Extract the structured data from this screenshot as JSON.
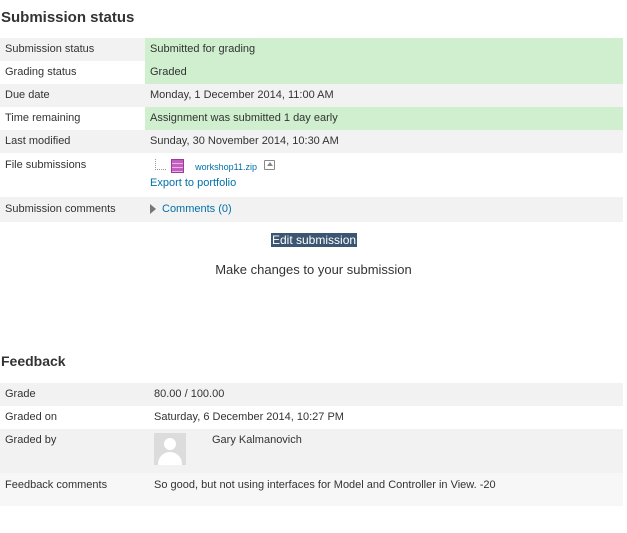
{
  "submission": {
    "heading": "Submission status",
    "rows": {
      "status": {
        "label": "Submission status",
        "value": "Submitted for grading"
      },
      "grading": {
        "label": "Grading status",
        "value": "Graded"
      },
      "due": {
        "label": "Due date",
        "value": "Monday, 1 December 2014, 11:00 AM"
      },
      "remaining": {
        "label": "Time remaining",
        "value": "Assignment was submitted 1 day early"
      },
      "modified": {
        "label": "Last modified",
        "value": "Sunday, 30 November 2014, 10:30 AM"
      },
      "files": {
        "label": "File submissions",
        "file_name": "workshop11.zip",
        "export_label": "Export to portfolio"
      },
      "comments": {
        "label": "Submission comments",
        "value": "Comments (0)"
      }
    },
    "edit_button": "Edit submission",
    "help_text": "Make changes to your submission"
  },
  "feedback": {
    "heading": "Feedback",
    "rows": {
      "grade": {
        "label": "Grade",
        "value": "80.00 / 100.00"
      },
      "graded_on": {
        "label": "Graded on",
        "value": "Saturday, 6 December 2014, 10:27 PM"
      },
      "graded_by": {
        "label": "Graded by",
        "value": "Gary Kalmanovich"
      },
      "comments": {
        "label": "Feedback comments",
        "value": "So good, but not using interfaces for Model and Controller in View. -20"
      }
    }
  },
  "colors": {
    "success_bg": "#cfefcf",
    "stripe_bg": "#f2f2f2",
    "link": "#0070a8",
    "button_bg": "#3a5672"
  },
  "icons": {
    "file": "zip-file-icon",
    "export": "portfolio-export-icon",
    "expand": "expand-triangle-icon",
    "avatar": "user-avatar-icon"
  }
}
